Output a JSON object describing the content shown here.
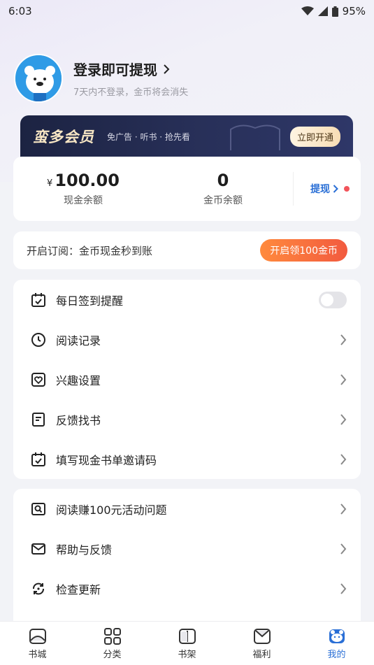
{
  "status": {
    "time": "6:03",
    "battery": "95%"
  },
  "profile": {
    "title": "登录即可提现",
    "subtitle": "7天内不登录，金币将会消失"
  },
  "vip": {
    "brand": "蛮多会员",
    "desc": "免广告 · 听书 · 抢先看",
    "button": "立即开通"
  },
  "balance": {
    "currency": "¥",
    "cash_value": "100.00",
    "cash_label": "现金余额",
    "gold_value": "0",
    "gold_label": "金币余额",
    "withdraw": "提现"
  },
  "subscribe": {
    "text": "开启订阅：金币现金秒到账",
    "button": "开启领100金币"
  },
  "menu1": [
    {
      "label": "每日签到提醒",
      "icon": "calendar-check-icon",
      "toggle": false
    },
    {
      "label": "阅读记录",
      "icon": "clock-icon"
    },
    {
      "label": "兴趣设置",
      "icon": "heart-icon"
    },
    {
      "label": "反馈找书",
      "icon": "document-icon"
    },
    {
      "label": "填写现金书单邀请码",
      "icon": "calendar-check-icon"
    }
  ],
  "menu2": [
    {
      "label": "阅读赚100元活动问题",
      "icon": "search-icon"
    },
    {
      "label": "帮助与反馈",
      "icon": "mail-icon"
    },
    {
      "label": "检查更新",
      "icon": "refresh-icon"
    }
  ],
  "tabs": [
    {
      "label": "书城",
      "icon": "home-icon"
    },
    {
      "label": "分类",
      "icon": "grid-icon"
    },
    {
      "label": "书架",
      "icon": "book-icon"
    },
    {
      "label": "福利",
      "icon": "gift-icon"
    },
    {
      "label": "我的",
      "icon": "bear-icon",
      "active": true
    }
  ],
  "colors": {
    "accent": "#2a6fd6",
    "orange": "#f25a3f",
    "vip_bg": "#1c2342"
  }
}
